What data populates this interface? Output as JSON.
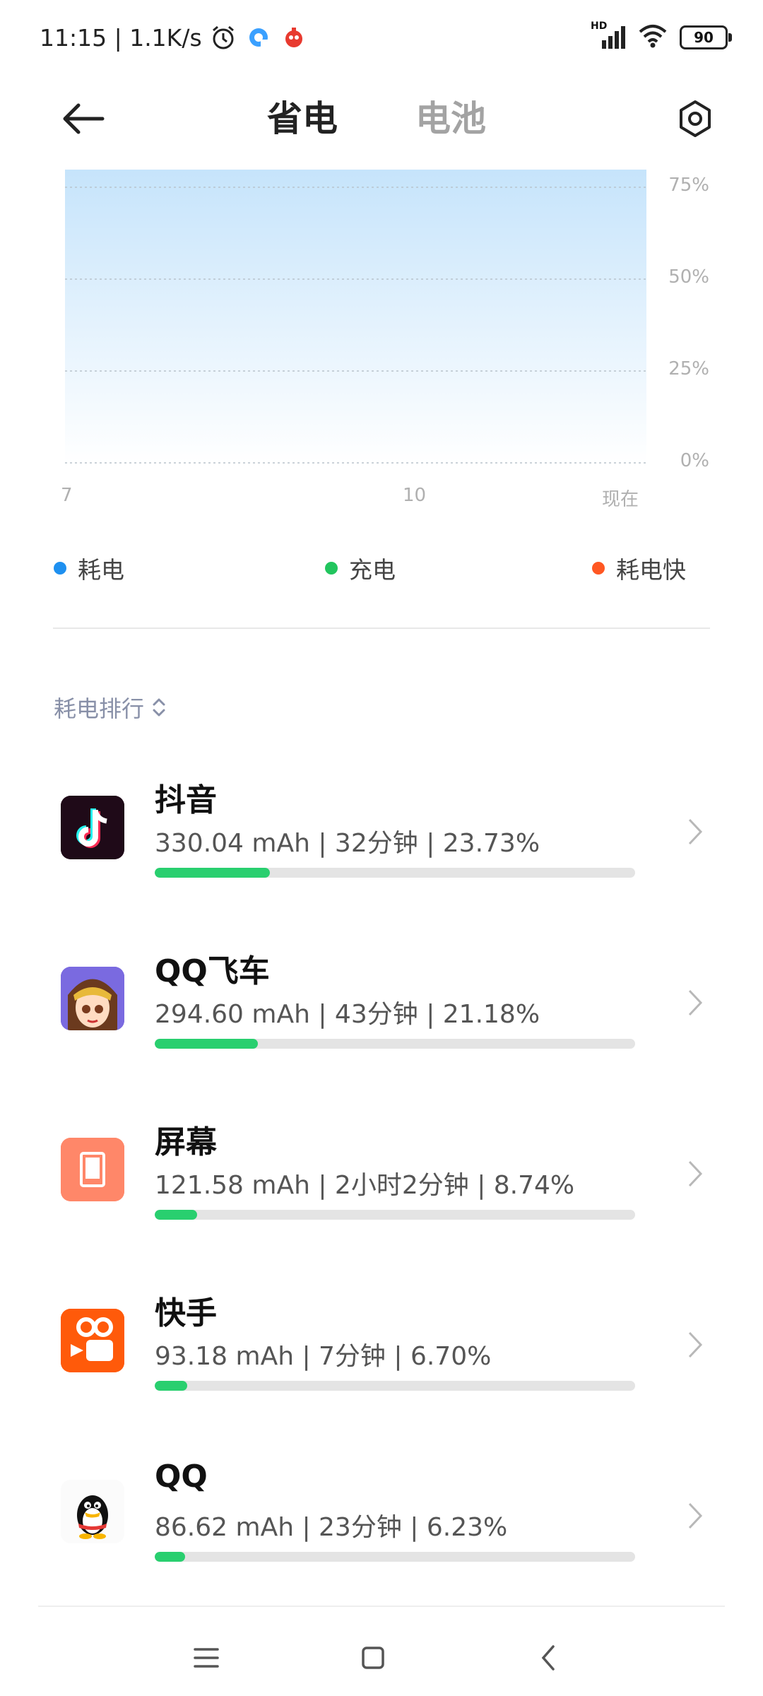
{
  "status_bar": {
    "time_speed": "11:15 | 1.1K/s",
    "network_type": "HD",
    "battery": "90"
  },
  "header": {
    "tab_active": "省电",
    "tab_inactive": "电池"
  },
  "chart_data": {
    "type": "area",
    "y_ticks": [
      "75%",
      "50%",
      "25%",
      "0%"
    ],
    "x_ticks": [
      "7",
      "10",
      "现在"
    ],
    "ylim": [
      0,
      75
    ],
    "fill_color": "#c9e6fc",
    "series": [
      {
        "values": [
          75,
          75
        ]
      }
    ]
  },
  "legend": {
    "items": [
      {
        "label": "耗电",
        "color": "#1e90f0"
      },
      {
        "label": "充电",
        "color": "#22c55e"
      },
      {
        "label": "耗电快",
        "color": "#ff5722"
      }
    ]
  },
  "sort": {
    "label": "耗电排行"
  },
  "apps": [
    {
      "name": "抖音",
      "stats": "330.04 mAh | 32分钟 | 23.73%",
      "percent": 23.73,
      "icon": "douyin-icon"
    },
    {
      "name": "QQ飞车",
      "stats": "294.60 mAh | 43分钟 | 21.18%",
      "percent": 21.18,
      "icon": "qq-speed-icon"
    },
    {
      "name": "屏幕",
      "stats": "121.58 mAh | 2小时2分钟 | 8.74%",
      "percent": 8.74,
      "icon": "screen-icon"
    },
    {
      "name": "快手",
      "stats": "93.18 mAh | 7分钟 | 6.70%",
      "percent": 6.7,
      "icon": "kuaishou-icon"
    },
    {
      "name": "QQ",
      "stats": "86.62 mAh | 23分钟 | 6.23%",
      "percent": 6.23,
      "icon": "qq-icon"
    }
  ],
  "colors": {
    "bar": "#29cf6f",
    "muted": "#a3a3a3"
  }
}
